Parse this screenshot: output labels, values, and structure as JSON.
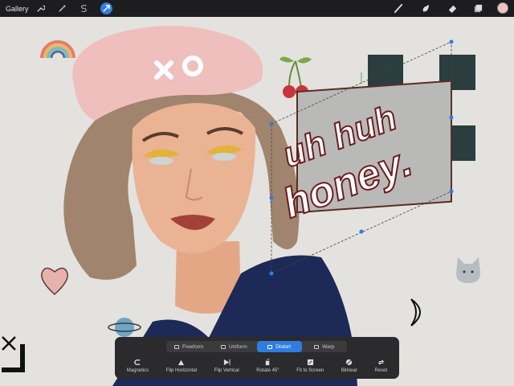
{
  "topbar": {
    "gallery_label": "Gallery",
    "swatch_color": "#f2c4bf",
    "left_tools": [
      "wrench-icon",
      "magic-wand-icon",
      "selection-icon",
      "transform-arrow-icon"
    ],
    "right_tools": [
      "brush-icon",
      "smudge-icon",
      "eraser-icon",
      "layers-icon"
    ]
  },
  "artwork": {
    "hat_text": "xo",
    "lettering_line1": "uh huh",
    "lettering_line2": "honey."
  },
  "transform": {
    "modes": [
      {
        "label": "Freeform",
        "active": false
      },
      {
        "label": "Uniform",
        "active": false
      },
      {
        "label": "Distort",
        "active": true
      },
      {
        "label": "Warp",
        "active": false
      }
    ],
    "actions": [
      {
        "label": "Magnetics",
        "icon": "magnet-icon"
      },
      {
        "label": "Flip Horizontal",
        "icon": "flip-horizontal-icon"
      },
      {
        "label": "Flip Vertical",
        "icon": "flip-vertical-icon"
      },
      {
        "label": "Rotate 45°",
        "icon": "rotate-icon"
      },
      {
        "label": "Fit to Screen",
        "icon": "fit-screen-icon"
      },
      {
        "label": "Bilinear",
        "icon": "bilinear-icon"
      },
      {
        "label": "Reset",
        "icon": "reset-icon"
      }
    ],
    "accent_color": "#2f7de1"
  }
}
